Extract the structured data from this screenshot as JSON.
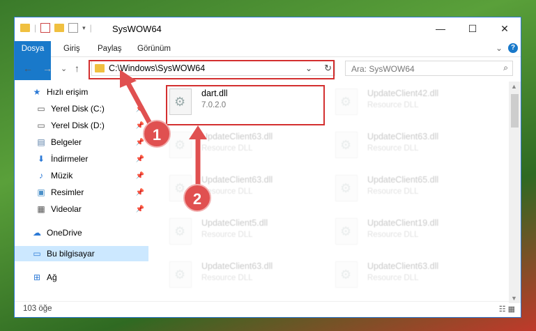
{
  "window": {
    "title": "SysWOW64",
    "controls": {
      "minimize": "—",
      "maximize": "☐",
      "close": "✕"
    }
  },
  "ribbon": {
    "tabs": [
      "Dosya",
      "Giriş",
      "Paylaş",
      "Görünüm"
    ],
    "collapse": "⌄",
    "help": "?"
  },
  "nav": {
    "back": "←",
    "forward": "→",
    "recent": "⌄",
    "up": "↑"
  },
  "address": {
    "path": "C:\\Windows\\SysWOW64",
    "dropdown": "⌄",
    "refresh": "↻"
  },
  "search": {
    "placeholder": "Ara: SysWOW64",
    "icon": "search-icon"
  },
  "sidebar": {
    "items": [
      {
        "label": "Hızlı erişim",
        "icon": "star-icon",
        "glyph": "★",
        "color": "#2b79d6"
      },
      {
        "label": "Yerel Disk (C:)",
        "icon": "drive-icon",
        "glyph": "▭",
        "color": "#555",
        "pinned": true
      },
      {
        "label": "Yerel Disk (D:)",
        "icon": "drive-icon",
        "glyph": "▭",
        "color": "#555",
        "pinned": true
      },
      {
        "label": "Belgeler",
        "icon": "documents-icon",
        "glyph": "▤",
        "color": "#5a7fa8",
        "pinned": true
      },
      {
        "label": "İndirmeler",
        "icon": "download-icon",
        "glyph": "⬇",
        "color": "#2b79d6",
        "pinned": true
      },
      {
        "label": "Müzik",
        "icon": "music-icon",
        "glyph": "♪",
        "color": "#2b79d6",
        "pinned": true
      },
      {
        "label": "Resimler",
        "icon": "pictures-icon",
        "glyph": "▣",
        "color": "#4a8fc8",
        "pinned": true
      },
      {
        "label": "Videolar",
        "icon": "video-icon",
        "glyph": "▦",
        "color": "#555",
        "pinned": true
      },
      {
        "label": "OneDrive",
        "icon": "cloud-icon",
        "glyph": "☁",
        "color": "#2b79d6"
      },
      {
        "label": "Bu bilgisayar",
        "icon": "computer-icon",
        "glyph": "▭",
        "color": "#2b79d6"
      },
      {
        "label": "Ağ",
        "icon": "network-icon",
        "glyph": "⊞",
        "color": "#2b79d6"
      }
    ]
  },
  "files": [
    {
      "name": "dart.dll",
      "sub": "7.0.2.0",
      "ghost": false
    },
    {
      "name": "UpdateClient42.dll",
      "sub": "Resource DLL",
      "ghost": true
    },
    {
      "name": "UpdateClient63.dll",
      "sub": "Resource DLL",
      "ghost": true
    },
    {
      "name": "UpdateClient63.dll",
      "sub": "Resource DLL",
      "ghost": true
    },
    {
      "name": "UpdateClient63.dll",
      "sub": "Resource DLL",
      "ghost": true
    },
    {
      "name": "UpdateClient65.dll",
      "sub": "Resource DLL",
      "ghost": true
    },
    {
      "name": "UpdateClient5.dll",
      "sub": "Resource DLL",
      "ghost": true
    },
    {
      "name": "UpdateClient19.dll",
      "sub": "Resource DLL",
      "ghost": true
    },
    {
      "name": "UpdateClient63.dll",
      "sub": "Resource DLL",
      "ghost": true
    },
    {
      "name": "UpdateClient63.dll",
      "sub": "Resource DLL",
      "ghost": true
    }
  ],
  "status": {
    "count": "103 öğe",
    "views": "☷ ▦"
  },
  "annotations": {
    "step1": "1",
    "step2": "2",
    "color": "#d32f2f"
  }
}
